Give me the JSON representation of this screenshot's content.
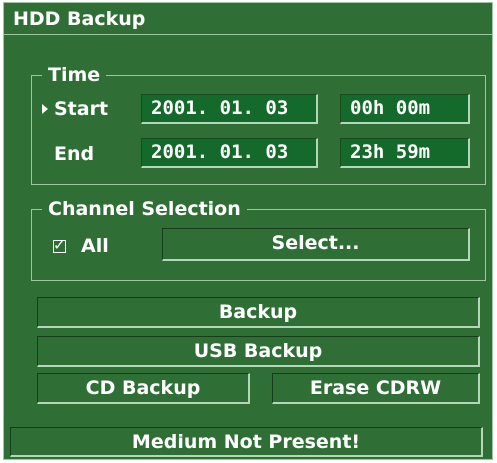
{
  "window": {
    "title": "HDD Backup"
  },
  "time": {
    "legend": "Time",
    "start": {
      "label": "Start",
      "date": "2001. 01. 03",
      "time": "00h 00m"
    },
    "end": {
      "label": "End",
      "date": "2001. 01. 03",
      "time": "23h 59m"
    }
  },
  "channel": {
    "legend": "Channel Selection",
    "all_label": "All",
    "all_checked": true,
    "select_label": "Select..."
  },
  "actions": {
    "backup": "Backup",
    "usb_backup": "USB Backup",
    "cd_backup": "CD Backup",
    "erase_cdrw": "Erase CDRW"
  },
  "status": {
    "message": "Medium Not Present!"
  },
  "colors": {
    "panel": "#2f6f36",
    "field": "#146a2b",
    "border": "#9ec6a2",
    "text": "#ffffff"
  }
}
